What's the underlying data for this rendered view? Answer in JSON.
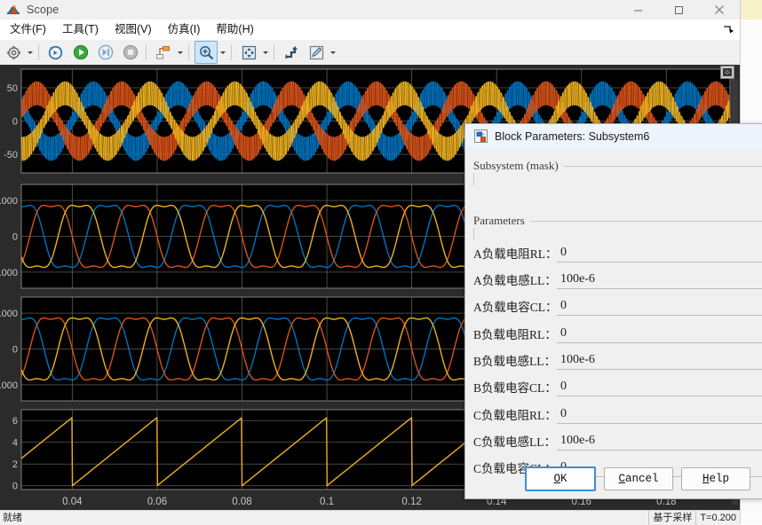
{
  "window": {
    "title": "Scope",
    "app_icon": "matlab-scope-icon",
    "controls": {
      "minimize": "minimize-icon",
      "maximize": "maximize-icon",
      "close": "close-icon"
    }
  },
  "menubar": {
    "items": [
      {
        "label": "文件(F)",
        "name": "menu-file"
      },
      {
        "label": "工具(T)",
        "name": "menu-tools"
      },
      {
        "label": "视图(V)",
        "name": "menu-view"
      },
      {
        "label": "仿真(I)",
        "name": "menu-simulation"
      },
      {
        "label": "帮助(H)",
        "name": "menu-help"
      }
    ],
    "overflow": "menu-overflow-icon"
  },
  "toolbar": {
    "buttons": [
      {
        "name": "configuration-properties-button",
        "icon": "gear-icon",
        "has_caret": true,
        "active": false
      },
      {
        "name": "rewind-button",
        "icon": "rewind-icon",
        "has_caret": false,
        "active": false
      },
      {
        "name": "run-button",
        "icon": "play-icon",
        "has_caret": false,
        "active": false
      },
      {
        "name": "step-forward-button",
        "icon": "step-forward-icon",
        "has_caret": false,
        "active": false
      },
      {
        "name": "stop-button",
        "icon": "stop-icon",
        "has_caret": false,
        "active": false
      },
      {
        "name": "signal-selection-button",
        "icon": "signal-selection-icon",
        "has_caret": true,
        "active": false
      },
      {
        "name": "zoom-in-button",
        "icon": "zoom-in-icon",
        "has_caret": true,
        "active": true
      },
      {
        "name": "fit-to-view-button",
        "icon": "fit-to-view-icon",
        "has_caret": true,
        "active": false
      },
      {
        "name": "cursor-measurements-button",
        "icon": "cursor-measurement-icon",
        "has_caret": false,
        "active": false
      },
      {
        "name": "annotation-button",
        "icon": "annotation-pencil-icon",
        "has_caret": true,
        "active": false
      }
    ]
  },
  "statusbar": {
    "left": "就绪",
    "cells": [
      "基于采样",
      "T=0.200"
    ]
  },
  "chart_data": [
    {
      "type": "line",
      "name": "plot-1-three-phase-pwm-current",
      "title": "",
      "xlabel": "",
      "ylabel": "",
      "xlim": [
        0.028,
        0.195
      ],
      "ylim": [
        -78,
        78
      ],
      "yticks": [
        50,
        0,
        -50
      ],
      "ytick_labels": [
        "50",
        "0",
        "-50"
      ],
      "grid": true,
      "legend": "none",
      "series": [
        {
          "name": "phase-a",
          "color": "#0072BD",
          "waveform": "pwm_envelope_sine",
          "amplitude": 58,
          "freq_hz": 50,
          "phase_deg": 0,
          "carrier_hz": 2000
        },
        {
          "name": "phase-b",
          "color": "#D95319",
          "waveform": "pwm_envelope_sine",
          "amplitude": 58,
          "freq_hz": 50,
          "phase_deg": -120,
          "carrier_hz": 2000
        },
        {
          "name": "phase-c",
          "color": "#EDB120",
          "waveform": "pwm_envelope_sine",
          "amplitude": 58,
          "freq_hz": 50,
          "phase_deg": 120,
          "carrier_hz": 2000
        }
      ]
    },
    {
      "type": "line",
      "name": "plot-2-three-phase-voltage",
      "title": "",
      "xlabel": "",
      "ylabel": "",
      "xlim": [
        0.028,
        0.195
      ],
      "ylim": [
        -1450,
        1450
      ],
      "yticks": [
        1000,
        0,
        -1000
      ],
      "ytick_labels": [
        "1000",
        "0",
        "-1000"
      ],
      "grid": true,
      "legend": "none",
      "series": [
        {
          "name": "phase-a",
          "color": "#0072BD",
          "waveform": "trapezoid_sine",
          "amplitude": 1080,
          "freq_hz": 50,
          "phase_deg": -60
        },
        {
          "name": "phase-b",
          "color": "#D95319",
          "waveform": "trapezoid_sine",
          "amplitude": 1080,
          "freq_hz": 50,
          "phase_deg": 180
        },
        {
          "name": "phase-c",
          "color": "#EDB120",
          "waveform": "trapezoid_sine",
          "amplitude": 1080,
          "freq_hz": 50,
          "phase_deg": 60
        }
      ]
    },
    {
      "type": "line",
      "name": "plot-3-three-phase-voltage-2",
      "title": "",
      "xlabel": "",
      "ylabel": "",
      "xlim": [
        0.028,
        0.195
      ],
      "ylim": [
        -1450,
        1450
      ],
      "yticks": [
        1000,
        0,
        -1000
      ],
      "ytick_labels": [
        "1000",
        "0",
        "-1000"
      ],
      "grid": true,
      "legend": "none",
      "series": [
        {
          "name": "phase-a",
          "color": "#0072BD",
          "waveform": "trapezoid_sine",
          "amplitude": 1080,
          "freq_hz": 50,
          "phase_deg": -60
        },
        {
          "name": "phase-b",
          "color": "#D95319",
          "waveform": "trapezoid_sine",
          "amplitude": 1080,
          "freq_hz": 50,
          "phase_deg": 180
        },
        {
          "name": "phase-c",
          "color": "#EDB120",
          "waveform": "trapezoid_sine",
          "amplitude": 1080,
          "freq_hz": 50,
          "phase_deg": 60
        }
      ]
    },
    {
      "type": "line",
      "name": "plot-4-phase-angle-sawtooth",
      "title": "",
      "xlabel": "",
      "ylabel": "",
      "xlim": [
        0.028,
        0.195
      ],
      "ylim": [
        -0.35,
        7.0
      ],
      "yticks": [
        6,
        4,
        2,
        0
      ],
      "ytick_labels": [
        "6",
        "4",
        "2",
        "0"
      ],
      "xticks": [
        0.04,
        0.06,
        0.08,
        0.1,
        0.12,
        0.14,
        0.16,
        0.18
      ],
      "xtick_labels": [
        "0.04",
        "0.06",
        "0.08",
        "0.1",
        "0.12",
        "0.14",
        "0.16",
        "0.18"
      ],
      "grid": true,
      "legend": "none",
      "series": [
        {
          "name": "theta",
          "color": "#EDB120",
          "waveform": "sawtooth",
          "amplitude": 6.283,
          "freq_hz": 50
        }
      ]
    }
  ],
  "dialog": {
    "icon": "simulink-block-icon",
    "title": "Block Parameters: Subsystem6",
    "groups": [
      {
        "name": "subsystem-group",
        "legend": "Subsystem  (mask)"
      },
      {
        "name": "params-group",
        "legend": "Parameters"
      }
    ],
    "parameters": [
      {
        "name": "a-load-resistance-rl",
        "label": "A负载电阻RL：",
        "value": "0"
      },
      {
        "name": "a-load-inductance-ll",
        "label": "A负载电感LL：",
        "value": "100e-6"
      },
      {
        "name": "a-load-capacitance-cl",
        "label": "A负载电容CL：",
        "value": "0"
      },
      {
        "name": "b-load-resistance-rl",
        "label": "B负载电阻RL：",
        "value": "0"
      },
      {
        "name": "b-load-inductance-ll",
        "label": "B负载电感LL：",
        "value": "100e-6"
      },
      {
        "name": "b-load-capacitance-cl",
        "label": "B负载电容CL：",
        "value": "0"
      },
      {
        "name": "c-load-resistance-rl",
        "label": "C负载电阻RL：",
        "value": "0"
      },
      {
        "name": "c-load-inductance-ll",
        "label": "C负载电感LL：",
        "value": "100e-6"
      },
      {
        "name": "c-load-capacitance-cl",
        "label": "C负载电容CL：",
        "value": "0"
      }
    ],
    "buttons": [
      {
        "name": "ok-button",
        "label": "OK",
        "mnemonic_index": 0,
        "default": true
      },
      {
        "name": "cancel-button",
        "label": "Cancel",
        "mnemonic_index": 0,
        "default": false
      },
      {
        "name": "help-button",
        "label": "Help",
        "mnemonic_index": 0,
        "default": false
      }
    ]
  },
  "colors": {
    "series_blue": "#0072BD",
    "series_orange": "#D95319",
    "series_yellow": "#EDB120",
    "plot_background": "#000000",
    "figure_background": "#2b2b2b",
    "grid": "#6e6e6e",
    "accent": "#3a8fd6"
  }
}
